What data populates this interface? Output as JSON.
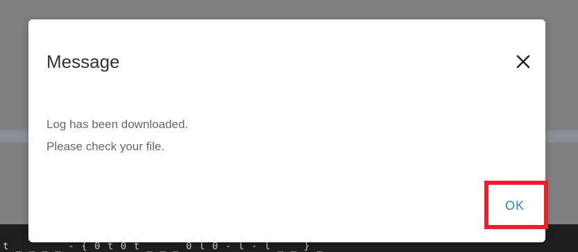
{
  "dialog": {
    "title": "Message",
    "message_lines": [
      "Log has been downloaded.",
      "Please check your file."
    ],
    "close_icon": "close-icon",
    "ok_label": "OK",
    "highlight_color": "#e8202a",
    "ok_color": "#2b7fd4"
  },
  "background": {
    "partial_text": "t _ _ _ _ - { 0 t 0 t _ _ _ 0 l 0 - l - l _ _ } _"
  }
}
